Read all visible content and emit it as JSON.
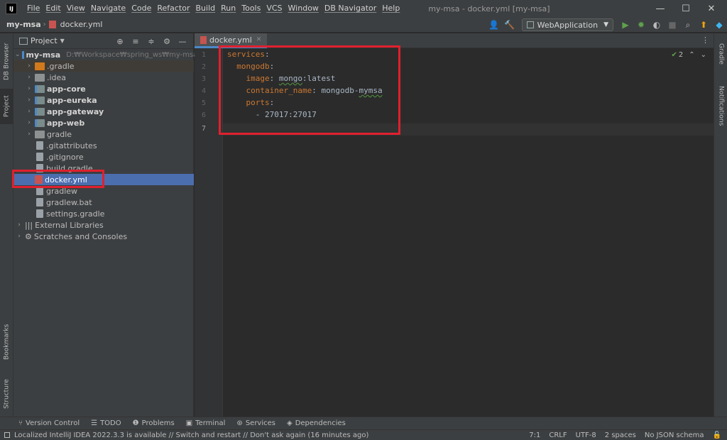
{
  "titlebar": {
    "logo": "IJ",
    "menu": [
      "File",
      "Edit",
      "View",
      "Navigate",
      "Code",
      "Refactor",
      "Build",
      "Run",
      "Tools",
      "VCS",
      "Window",
      "DB Navigator",
      "Help"
    ],
    "window_title": "my-msa - docker.yml [my-msa]",
    "minimize": "—",
    "maximize": "☐",
    "close": "✕"
  },
  "navbar": {
    "breadcrumb": [
      "my-msa",
      "docker.yml"
    ],
    "run_config": "WebApplication"
  },
  "left_strip": {
    "db_browser": "DB Browser",
    "project": "Project",
    "bookmarks": "Bookmarks",
    "structure": "Structure"
  },
  "right_strip": {
    "gradle": "Gradle",
    "notifications": "Notifications"
  },
  "project_panel": {
    "title": "Project",
    "tree": [
      {
        "label": "my-msa",
        "hint": "D:₩Workspace₩spring_ws₩my-msa"
      },
      {
        "label": ".gradle"
      },
      {
        "label": ".idea"
      },
      {
        "label": "app-core"
      },
      {
        "label": "app-eureka"
      },
      {
        "label": "app-gateway"
      },
      {
        "label": "app-web"
      },
      {
        "label": "gradle"
      },
      {
        "label": ".gitattributes"
      },
      {
        "label": ".gitignore"
      },
      {
        "label": "build.gradle"
      },
      {
        "label": "docker.yml"
      },
      {
        "label": "gradlew"
      },
      {
        "label": "gradlew.bat"
      },
      {
        "label": "settings.gradle"
      },
      {
        "label": "External Libraries"
      },
      {
        "label": "Scratches and Consoles"
      }
    ]
  },
  "editor": {
    "tab": "docker.yml",
    "inspection_count": "2",
    "line_numbers": [
      "1",
      "2",
      "3",
      "4",
      "5",
      "6",
      "7"
    ],
    "lines": {
      "l1_key": "services",
      "l2_key": "mongodb",
      "l3_key": "image",
      "l3_val_a": "mongo",
      "l3_val_b": ":latest",
      "l4_key": "container_name",
      "l4_val_a": "mongodb-",
      "l4_val_b": "mymsa",
      "l5_key": "ports",
      "l6_val": "- 27017:27017",
      "colon": ":"
    }
  },
  "bottom_tools": [
    "Version Control",
    "TODO",
    "Problems",
    "Terminal",
    "Services",
    "Dependencies"
  ],
  "status": {
    "message": "Localized IntelliJ IDEA 2022.3.3 is available // Switch and restart // Don't ask again (16 minutes ago)",
    "position": "7:1",
    "line_sep": "CRLF",
    "encoding": "UTF-8",
    "indent": "2 spaces",
    "schema": "No JSON schema"
  }
}
